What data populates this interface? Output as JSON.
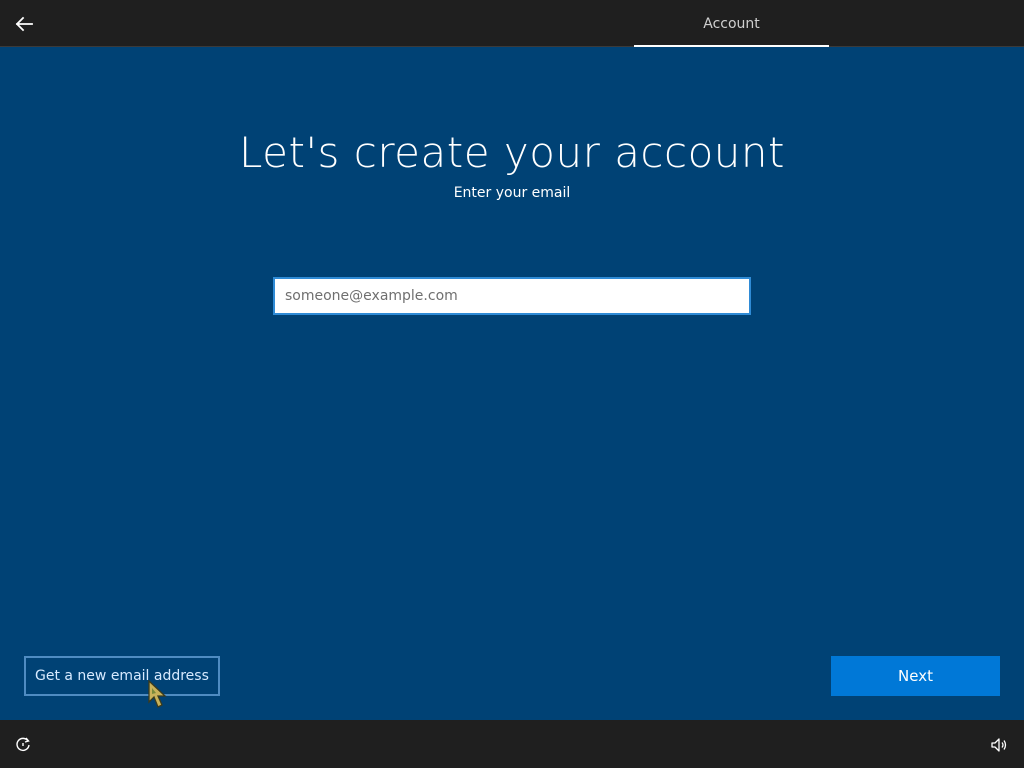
{
  "header": {
    "back_icon": "back-arrow-icon",
    "tab_label": "Account"
  },
  "main": {
    "title": "Let's create your account",
    "subtitle": "Enter your email",
    "email": {
      "value": "",
      "placeholder": "someone@example.com"
    },
    "new_email_link": "Get a new email address",
    "next_label": "Next"
  },
  "footer": {
    "ease_of_access_icon": "ease-of-access-icon",
    "volume_icon": "volume-icon"
  },
  "colors": {
    "background": "#004275",
    "bar": "#1f1f1f",
    "accent": "#0078d7",
    "input_border": "#2f8bd6"
  }
}
